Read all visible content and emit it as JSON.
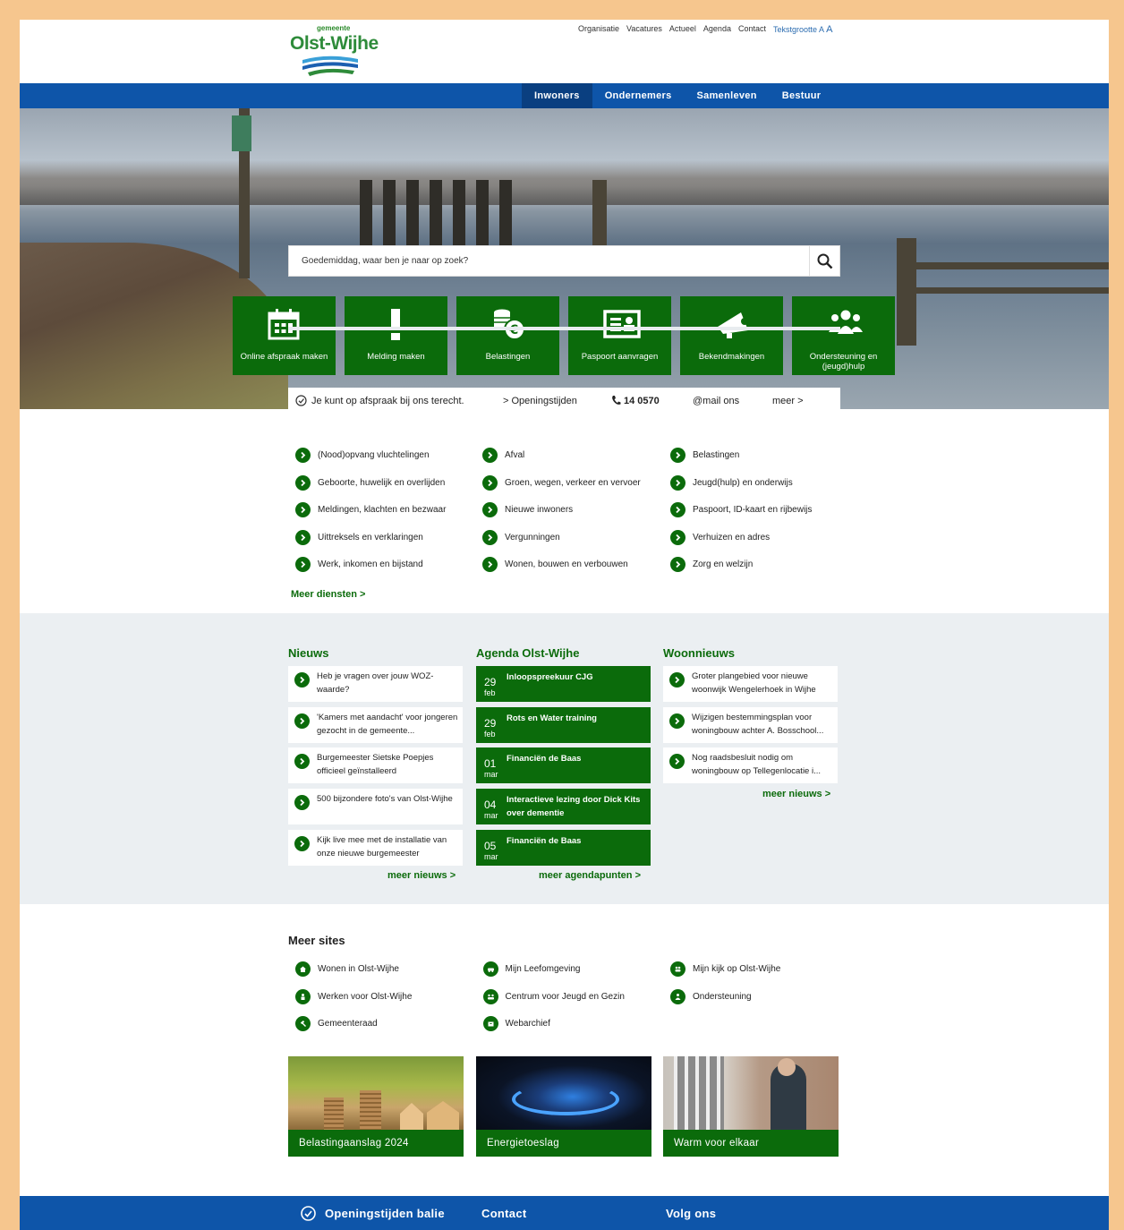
{
  "brand": {
    "prefix": "gemeente",
    "name": "Olst-Wijhe",
    "primary": "#0e55a9",
    "green": "#0b6b0b"
  },
  "utility_nav": [
    "Organisatie",
    "Vacatures",
    "Actueel",
    "Agenda",
    "Contact"
  ],
  "text_size": {
    "label": "Tekstgrootte",
    "a1": "A",
    "a2": "A"
  },
  "main_nav": [
    "Inwoners",
    "Ondernemers",
    "Samenleven",
    "Bestuur"
  ],
  "search": {
    "placeholder": "Goedemiddag, waar ben je naar op zoek?"
  },
  "tiles": [
    {
      "label": "Online afspraak maken",
      "icon": "calendar-icon"
    },
    {
      "label": "Melding maken",
      "icon": "exclamation-icon"
    },
    {
      "label": "Belastingen",
      "icon": "coins-euro-icon"
    },
    {
      "label": "Paspoort aanvragen",
      "icon": "id-card-icon"
    },
    {
      "label": "Bekendmakingen",
      "icon": "megaphone-icon"
    },
    {
      "label": "Ondersteuning en (jeugd)hulp",
      "icon": "people-icon"
    }
  ],
  "infobar": {
    "appointment": "Je kunt op afspraak bij ons terecht.",
    "hours": "> Openingstijden",
    "phone": "14 0570",
    "mail": "@mail ons",
    "more": "meer >"
  },
  "services": [
    [
      "(Nood)opvang vluchtelingen",
      "Afval",
      "Belastingen"
    ],
    [
      "Geboorte, huwelijk en overlijden",
      "Groen, wegen, verkeer en vervoer",
      "Jeugd(hulp) en onderwijs"
    ],
    [
      "Meldingen, klachten en bezwaar",
      "Nieuwe inwoners",
      "Paspoort, ID-kaart en rijbewijs"
    ],
    [
      "Uittreksels en verklaringen",
      "Vergunningen",
      "Verhuizen en adres"
    ],
    [
      "Werk, inkomen en bijstand",
      "Wonen, bouwen en verbouwen",
      "Zorg en welzijn"
    ]
  ],
  "more_services": "Meer diensten >",
  "news": {
    "title": "Nieuws",
    "items": [
      "Heb je vragen over jouw WOZ-waarde?",
      "'Kamers met aandacht' voor jongeren gezocht in de gemeente...",
      "Burgemeester Sietske Poepjes officieel geïnstalleerd",
      "500 bijzondere foto's van Olst-Wijhe",
      "Kijk live mee met de installatie van onze nieuwe burgemeester"
    ],
    "more": "meer nieuws >"
  },
  "agenda": {
    "title": "Agenda Olst-Wijhe",
    "items": [
      {
        "day": "29",
        "month": "feb",
        "title": "Inloopspreekuur CJG"
      },
      {
        "day": "29",
        "month": "feb",
        "title": "Rots en Water training"
      },
      {
        "day": "01",
        "month": "mar",
        "title": "Financiën de Baas"
      },
      {
        "day": "04",
        "month": "mar",
        "title": "Interactieve lezing door Dick Kits over dementie"
      },
      {
        "day": "05",
        "month": "mar",
        "title": "Financiën de Baas"
      }
    ],
    "more": "meer agendapunten >"
  },
  "housing": {
    "title": "Woonnieuws",
    "items": [
      "Groter plangebied voor nieuwe woonwijk Wengelerhoek in Wijhe",
      "Wijzigen bestemmingsplan voor woningbouw achter A. Bosschool...",
      "Nog raadsbesluit nodig om woningbouw op Tellegenlocatie i..."
    ],
    "more": "meer nieuws >"
  },
  "more_sites": {
    "title": "Meer sites",
    "items": [
      {
        "label": "Wonen in Olst-Wijhe",
        "icon": "house-icon"
      },
      {
        "label": "Mijn Leefomgeving",
        "icon": "car-icon"
      },
      {
        "label": "Mijn kijk op Olst-Wijhe",
        "icon": "people-icon"
      },
      {
        "label": "Werken voor Olst-Wijhe",
        "icon": "worker-icon"
      },
      {
        "label": "Centrum voor Jeugd en Gezin",
        "icon": "family-icon"
      },
      {
        "label": "Ondersteuning",
        "icon": "support-icon"
      },
      {
        "label": "Gemeenteraad",
        "icon": "gavel-icon"
      },
      {
        "label": "Webarchief",
        "icon": "archive-icon"
      }
    ]
  },
  "promos": [
    "Belastingaanslag 2024",
    "Energietoeslag",
    "Warm voor elkaar"
  ],
  "footer": {
    "hours": "Openingstijden balie",
    "contact": "Contact",
    "follow": "Volg ons"
  }
}
